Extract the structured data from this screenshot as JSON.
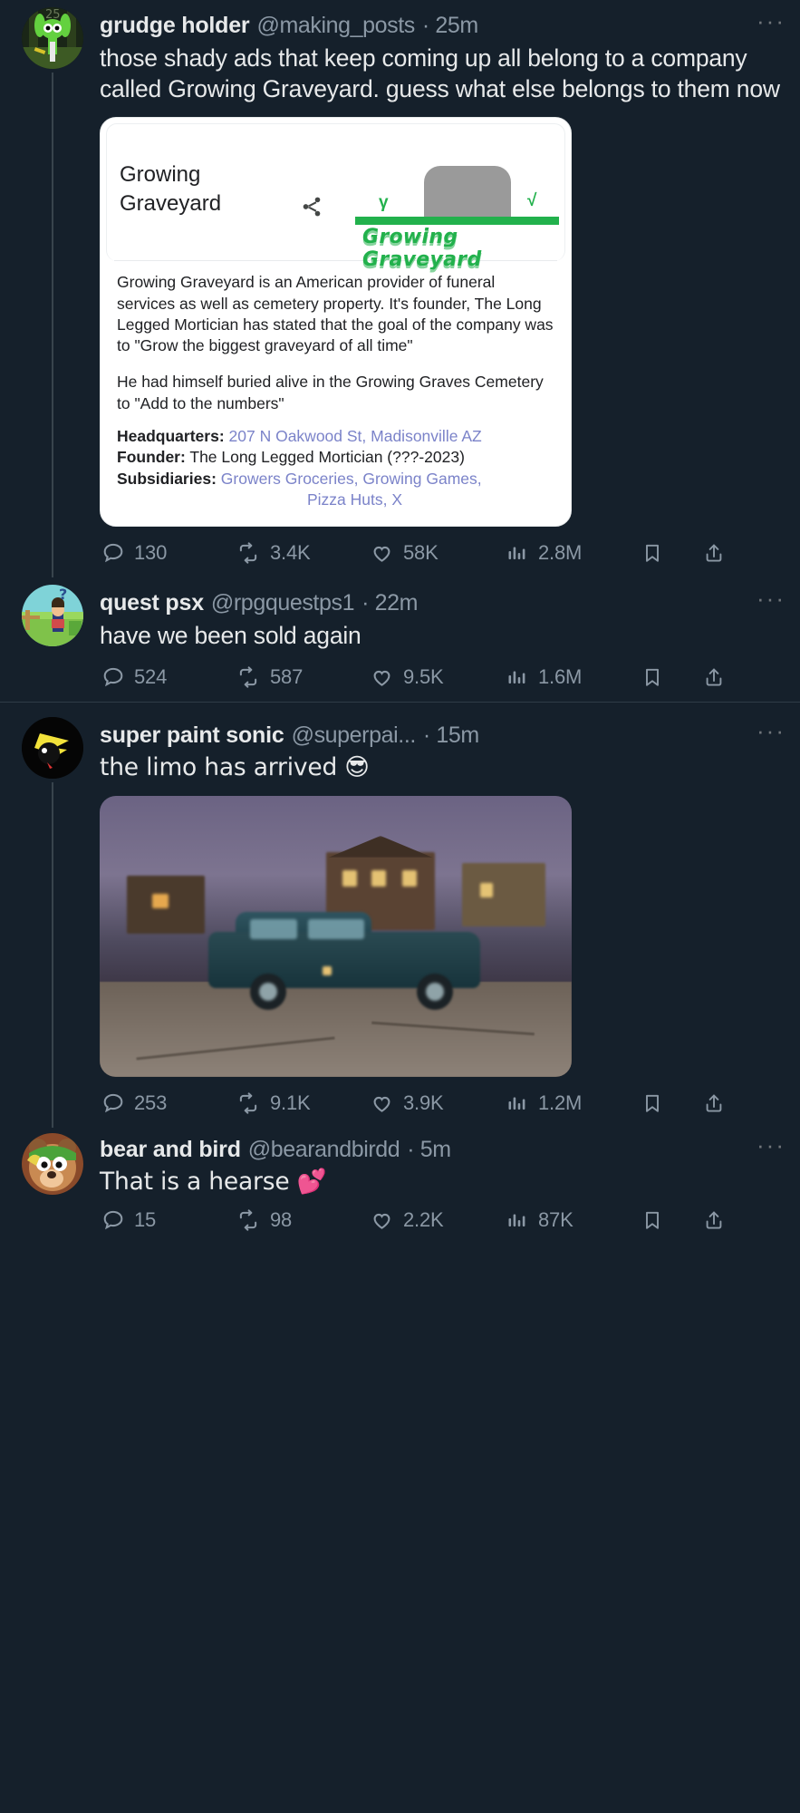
{
  "posts": [
    {
      "display_name": "grudge holder",
      "handle": "@making_posts",
      "time": "· 25m",
      "more_label": "···",
      "text": "those shady ads that keep coming up all belong to a company called Growing Graveyard. guess what else belongs to them now",
      "card": {
        "title_line1": "Growing",
        "title_line2": "Graveyard",
        "logo_text": "Growing Graveyard",
        "paragraph1": "Growing Graveyard is an American provider of funeral services as well as cemetery property. It's founder, The Long Legged Mortician has stated that the goal of the company was to \"Grow the biggest graveyard of all time\"",
        "paragraph2": "He had himself buried alive in the Growing Graves Cemetery to \"Add to the numbers\"",
        "rows": [
          {
            "key": "Headquarters:",
            "value": "207 N Oakwood St, Madisonville AZ",
            "link": true
          },
          {
            "key": "Founder:",
            "value": "The Long Legged Mortician (???-2023)",
            "link": false
          },
          {
            "key": "Subsidiaries:",
            "value": "Growers Groceries, Growing Games,",
            "value2": "Pizza Huts, X",
            "link": true
          }
        ]
      },
      "stats": {
        "replies": "130",
        "reposts": "3.4K",
        "likes": "58K",
        "views": "2.8M"
      }
    },
    {
      "display_name": "quest psx",
      "handle": "@rpgquestps1",
      "time": "· 22m",
      "more_label": "···",
      "text": "have we been sold again",
      "stats": {
        "replies": "524",
        "reposts": "587",
        "likes": "9.5K",
        "views": "1.6M"
      }
    },
    {
      "display_name": "super paint sonic",
      "handle": "@superpai...",
      "time": "· 15m",
      "more_label": "···",
      "text": "the limo has arrived 😎",
      "stats": {
        "replies": "253",
        "reposts": "9.1K",
        "likes": "3.9K",
        "views": "1.2M"
      }
    },
    {
      "display_name": "bear and bird",
      "handle": "@bearandbirdd",
      "time": "· 5m",
      "more_label": "···",
      "text": "That is a hearse 💕",
      "stats": {
        "replies": "15",
        "reposts": "98",
        "likes": "2.2K",
        "views": "87K"
      }
    }
  ],
  "icons": {
    "reply": "reply-icon",
    "repost": "repost-icon",
    "like": "like-icon",
    "views": "views-icon",
    "bookmark": "bookmark-icon",
    "share": "share-icon",
    "more": "more-options-icon"
  },
  "colors": {
    "background": "#15202b",
    "text_primary": "#e7e9ea",
    "text_secondary": "#8b98a5",
    "divider": "#2f3b47",
    "brand_green": "#22b14c",
    "wiki_link": "#7b83c9"
  }
}
